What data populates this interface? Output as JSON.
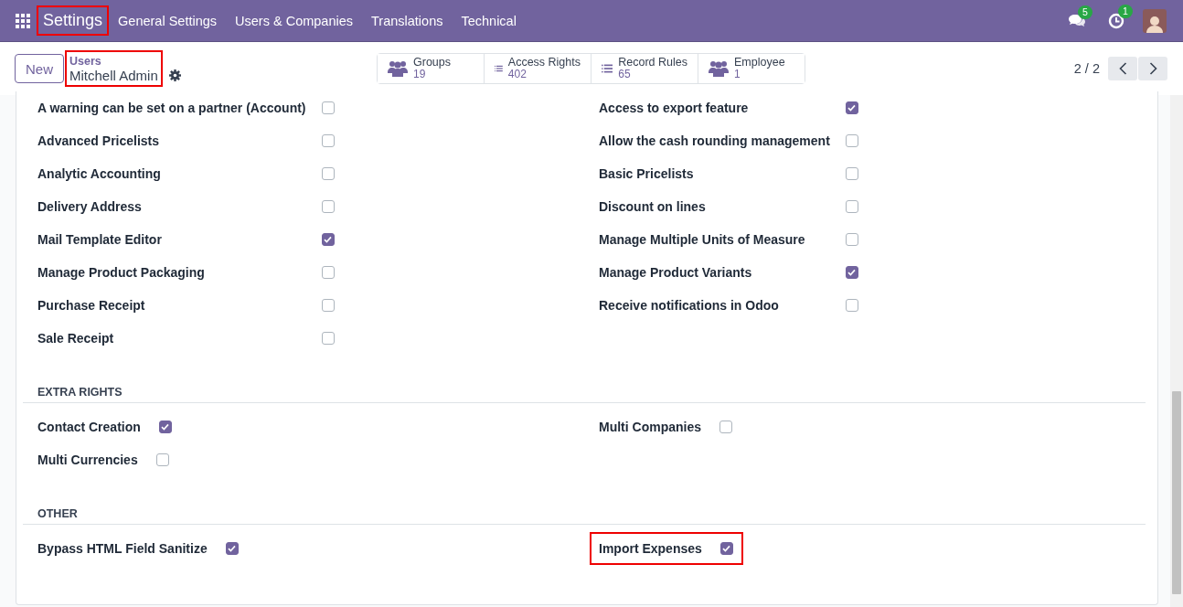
{
  "navbar": {
    "app": {
      "label": "Settings",
      "highlighted": true
    },
    "menu": [
      "General Settings",
      "Users & Companies",
      "Translations",
      "Technical"
    ],
    "systray": [
      {
        "kind": "chat",
        "badge": "5"
      },
      {
        "kind": "activity",
        "badge": "1"
      }
    ]
  },
  "control_panel": {
    "new_button": "New",
    "breadcrumb": {
      "parent": "Users",
      "current": "Mitchell Admin",
      "highlighted": true
    },
    "smart_buttons": [
      {
        "kind": "people",
        "label": "Groups",
        "count": "19"
      },
      {
        "kind": "list",
        "label": "Access Rights",
        "count": "402"
      },
      {
        "kind": "list",
        "label": "Record Rules",
        "count": "65"
      },
      {
        "kind": "people",
        "label": "Employee",
        "count": "1"
      }
    ],
    "pager": "2 / 2"
  },
  "sections": [
    {
      "kind": "table",
      "columns": [
        [
          {
            "label": "A warning can be set on a partner (Account)",
            "checked": false,
            "highlighted": false
          },
          {
            "label": "Advanced Pricelists",
            "checked": false,
            "highlighted": false
          },
          {
            "label": "Analytic Accounting",
            "checked": false,
            "highlighted": false
          },
          {
            "label": "Delivery Address",
            "checked": false,
            "highlighted": false
          },
          {
            "label": "Mail Template Editor",
            "checked": true,
            "highlighted": false
          },
          {
            "label": "Manage Product Packaging",
            "checked": false,
            "highlighted": false
          },
          {
            "label": "Purchase Receipt",
            "checked": false,
            "highlighted": false
          },
          {
            "label": "Sale Receipt",
            "checked": false,
            "highlighted": false
          }
        ],
        [
          {
            "label": "Access to export feature",
            "checked": true,
            "highlighted": false
          },
          {
            "label": "Allow the cash rounding management",
            "checked": false,
            "highlighted": false
          },
          {
            "label": "Basic Pricelists",
            "checked": false,
            "highlighted": false
          },
          {
            "label": "Discount on lines",
            "checked": false,
            "highlighted": false
          },
          {
            "label": "Manage Multiple Units of Measure",
            "checked": false,
            "highlighted": false
          },
          {
            "label": "Manage Product Variants",
            "checked": true,
            "highlighted": false
          },
          {
            "label": "Receive notifications in Odoo",
            "checked": false,
            "highlighted": false
          }
        ]
      ]
    },
    {
      "kind": "inline",
      "title": "EXTRA RIGHTS",
      "columns": [
        [
          {
            "label": "Contact Creation",
            "checked": true,
            "highlighted": false
          },
          {
            "label": "Multi Currencies",
            "checked": false,
            "highlighted": false
          }
        ],
        [
          {
            "label": "Multi Companies",
            "checked": false,
            "highlighted": false
          }
        ]
      ]
    },
    {
      "kind": "inline",
      "title": "OTHER",
      "columns": [
        [
          {
            "label": "Bypass HTML Field Sanitize",
            "checked": true,
            "highlighted": false
          }
        ],
        [
          {
            "label": "Import Expenses",
            "checked": true,
            "highlighted": true
          }
        ]
      ]
    }
  ]
}
